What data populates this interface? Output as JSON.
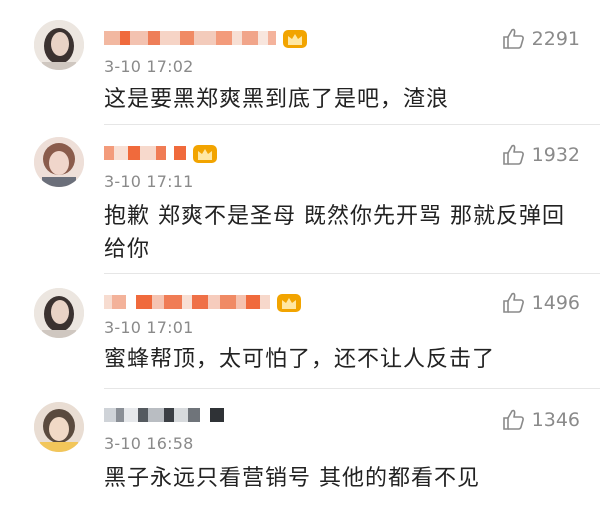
{
  "comments": [
    {
      "timestamp": "3-10 17:02",
      "text": "这是要黑郑爽黑到底了是吧，渣浪",
      "likes": "2291",
      "avatar_icon": "user-avatar-blurred",
      "vip_icon": "crown-badge-icon"
    },
    {
      "timestamp": "3-10 17:11",
      "text": "抱歉 郑爽不是圣母 既然你先开骂 那就反弹回给你",
      "likes": "1932",
      "avatar_icon": "user-avatar-blurred",
      "vip_icon": "crown-badge-icon"
    },
    {
      "timestamp": "3-10 17:01",
      "text": "蜜蜂帮顶，太可怕了，还不让人反击了",
      "likes": "1496",
      "avatar_icon": "user-avatar-blurred",
      "vip_icon": "crown-badge-icon"
    },
    {
      "timestamp": "3-10 16:58",
      "text": "黑子永远只看营销号 其他的都看不见",
      "likes": "1346",
      "avatar_icon": "user-avatar-blurred",
      "vip_icon": ""
    }
  ],
  "colors": {
    "username_blur": [
      "#f3a58a",
      "#f06a3c",
      "#e9c5b6",
      "#d9d9d9"
    ],
    "crown": "#f0a000",
    "timestamp": "#8a8a8a",
    "like": "#8a8a8a"
  }
}
